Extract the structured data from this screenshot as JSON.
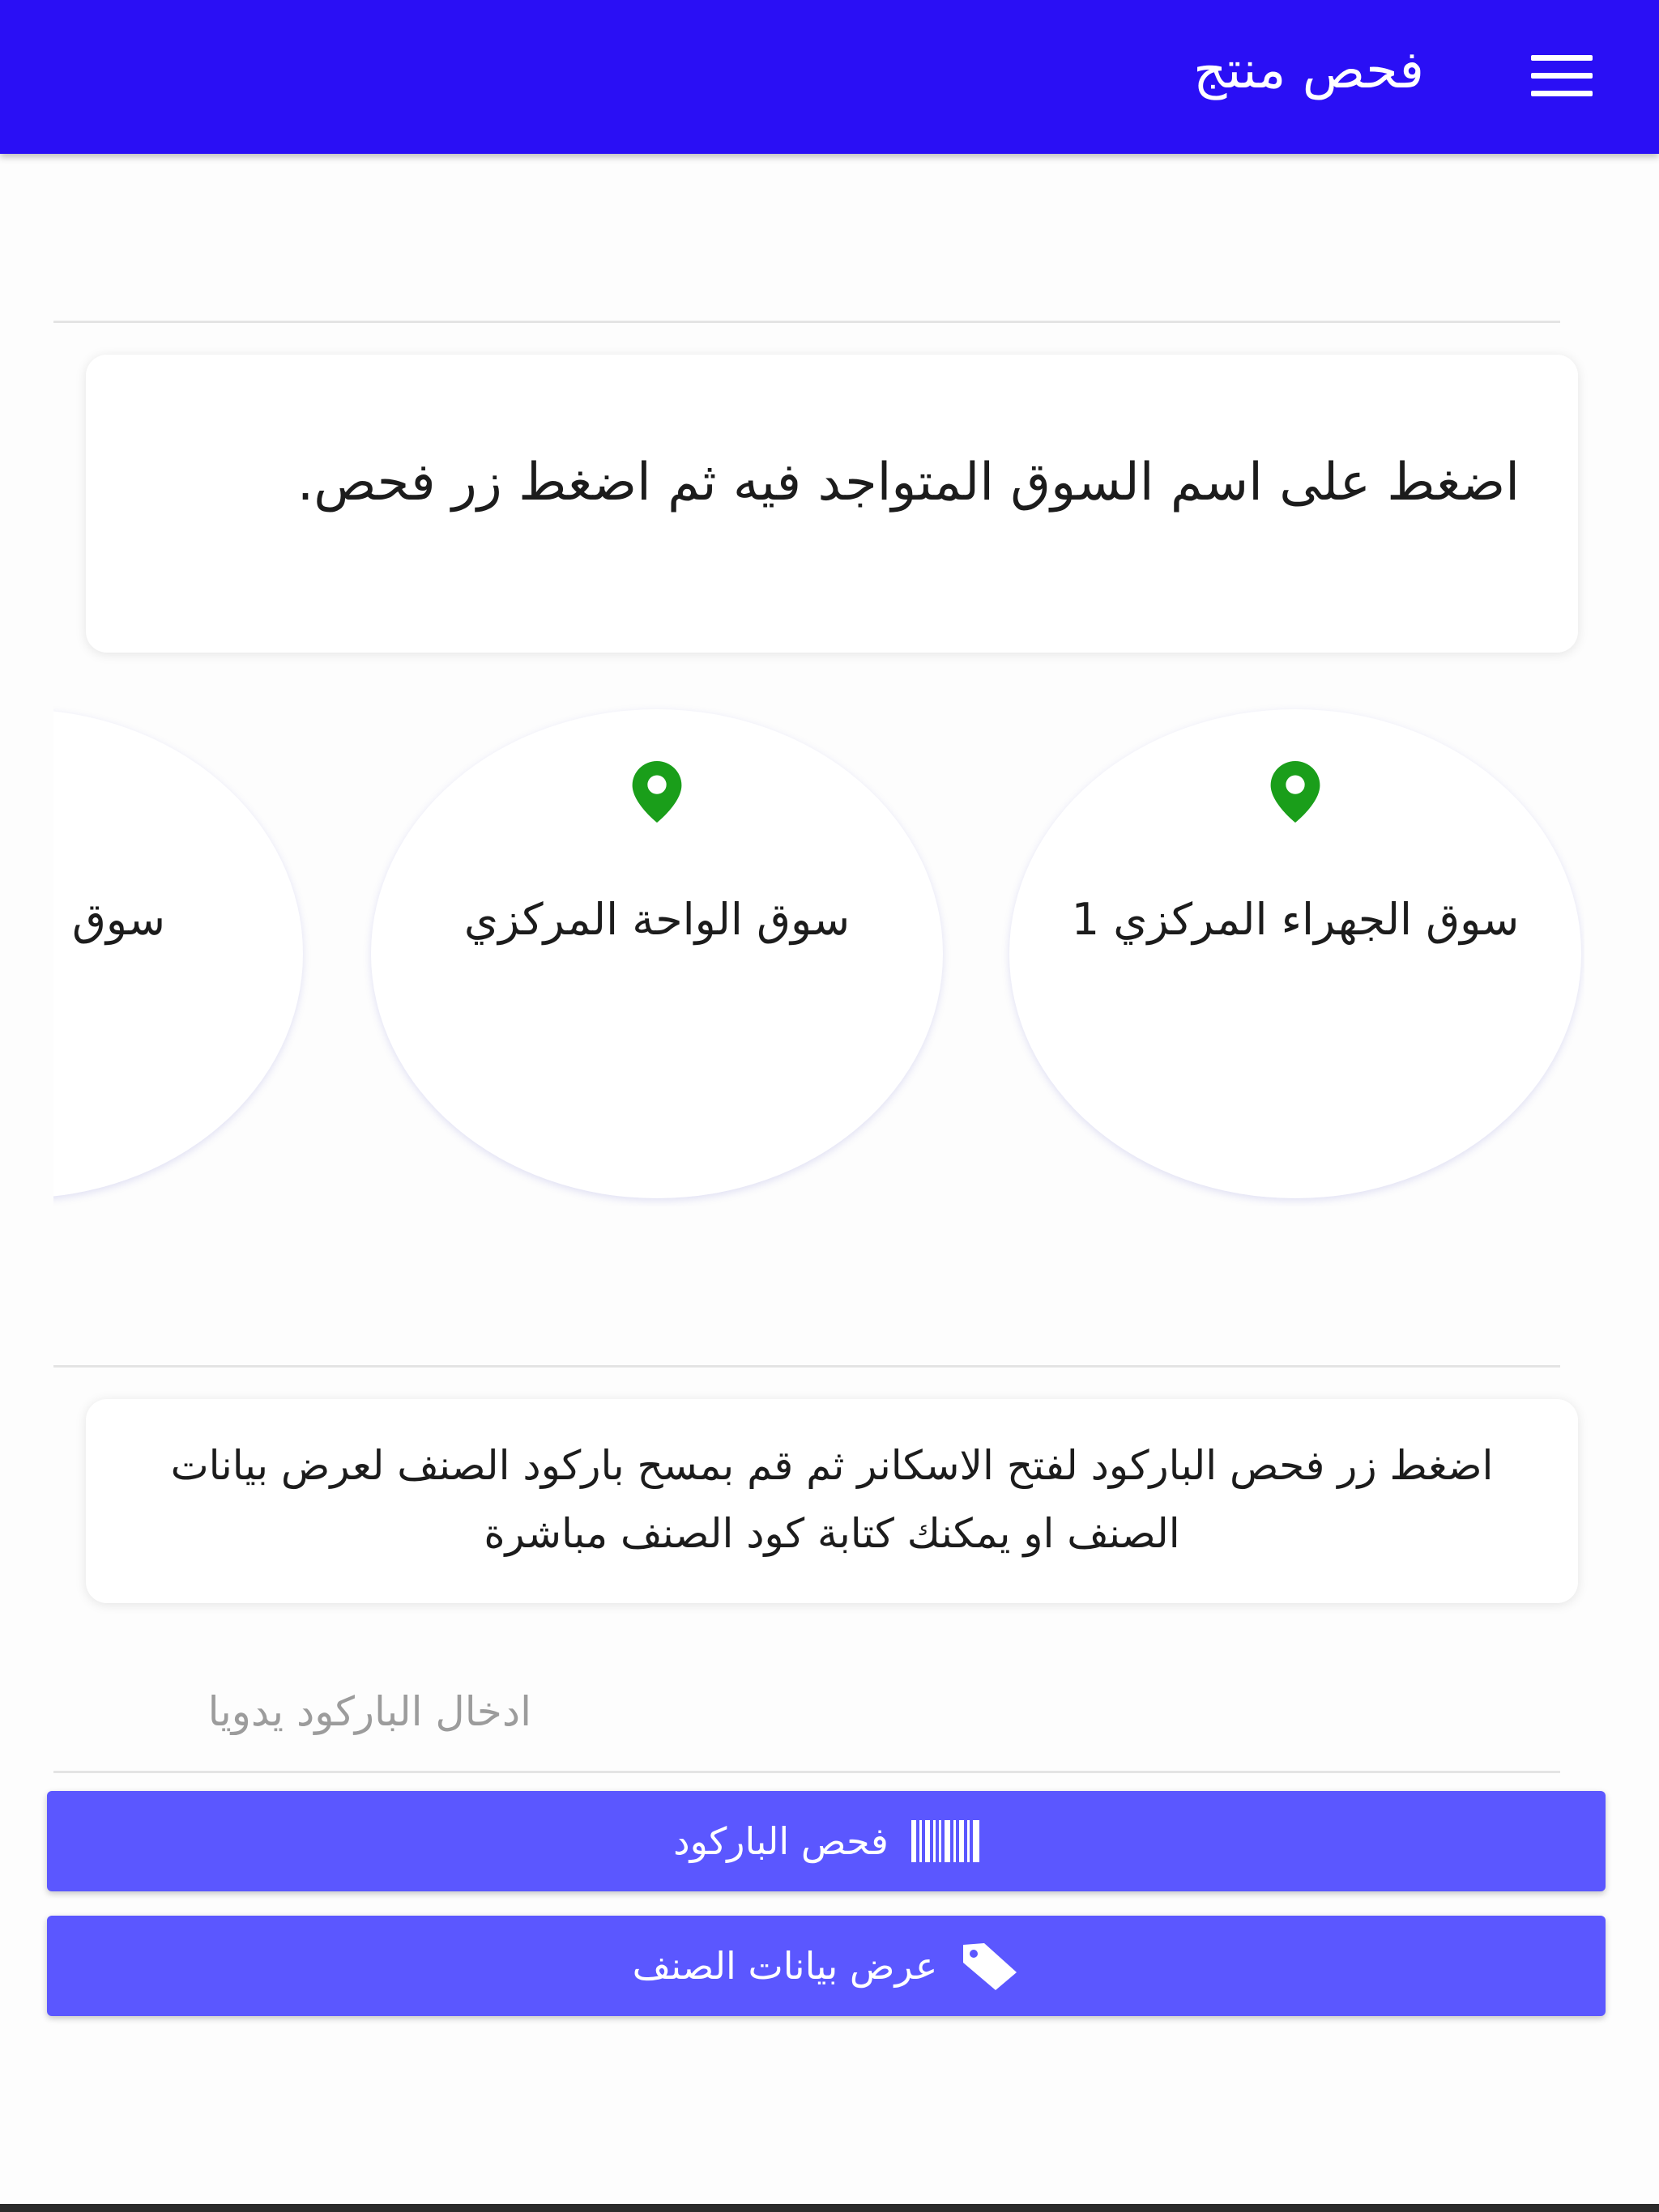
{
  "header": {
    "title": "فحص منتج",
    "menu_icon": "hamburger-menu-icon",
    "background": "#2a0ff5"
  },
  "instructions": {
    "market_hint": "اضغط على اسم السوق المتواجد فيه ثم اضغط زر فحص.",
    "barcode_hint": "اضغط زر فحص الباركود لفتح الاسكانر ثم قم بمسح باركود الصنف لعرض بيانات الصنف او يمكنك كتابة كود الصنف مباشرة"
  },
  "markets": [
    {
      "name": "سوق الجهراء المركزي 1",
      "icon": "location-pin-icon"
    },
    {
      "name": "سوق الواحة المركزي",
      "icon": "location-pin-icon"
    },
    {
      "name": "سوق"
    }
  ],
  "barcode_input": {
    "placeholder": "ادخال الباركود يدويا",
    "value": ""
  },
  "buttons": {
    "scan_barcode": {
      "label": "فحص الباركود",
      "icon": "barcode-icon"
    },
    "show_item_data": {
      "label": "عرض بيانات الصنف",
      "icon": "tag-icon"
    }
  },
  "colors": {
    "accent": "#2a0ff5",
    "button": "#5b57ff",
    "pin": "#1a9e1a"
  }
}
